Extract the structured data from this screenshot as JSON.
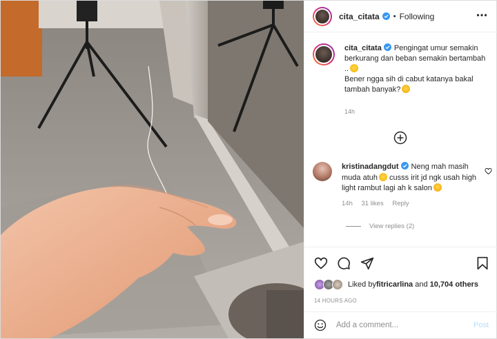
{
  "header": {
    "username": "cita_citata",
    "separator": "•",
    "follow_status": "Following"
  },
  "caption": {
    "username": "cita_citata",
    "line1": "Pengingat umur semakin berkurang dan beban semakin bertambah ..",
    "line2": "Bener ngga sih di cabut katanya bakal tambah banyak?",
    "time": "14h"
  },
  "comment": {
    "username": "kristinadangdut",
    "text_part1": "Neng mah masih muda atuh",
    "text_part2": " cusss irit jd ngk usah high light rambut lagi ah k salon",
    "time": "14h",
    "likes": "31 likes",
    "reply_label": "Reply",
    "view_replies": "View replies (2)"
  },
  "likes": {
    "prefix": "Liked by ",
    "user": "fitricarlina",
    "middle": " and ",
    "count": "10,704 others"
  },
  "post_time": "14 HOURS AGO",
  "add_comment": {
    "placeholder": "Add a comment...",
    "post_label": "Post"
  },
  "colors": {
    "verified": "#3897f0",
    "post_disabled": "#b2dffc",
    "muted_text": "#8e8e8e"
  },
  "icons": [
    "verified-badge-icon",
    "more-options-icon",
    "load-more-icon",
    "heart-icon",
    "comment-icon",
    "share-icon",
    "save-icon",
    "emoji-icon"
  ]
}
